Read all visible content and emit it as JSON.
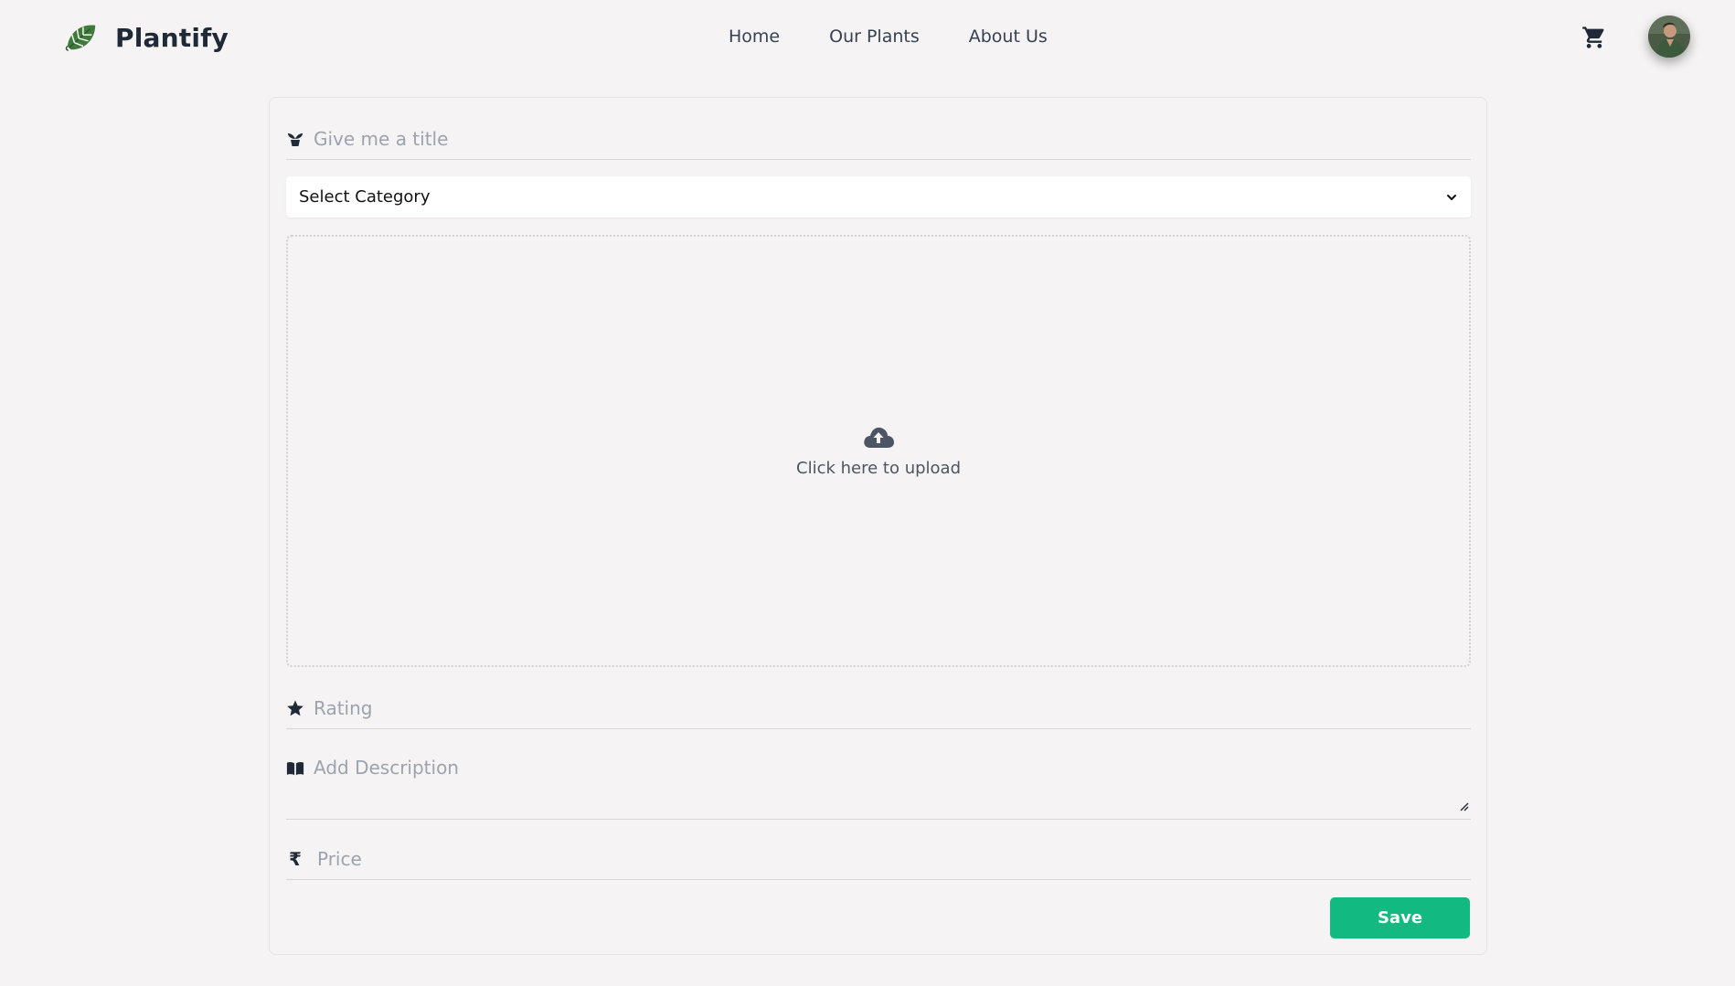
{
  "header": {
    "brand": "Plantify",
    "nav": [
      "Home",
      "Our Plants",
      "About Us"
    ]
  },
  "form": {
    "title_placeholder": "Give me a title",
    "category_selected": "Select Category",
    "upload_label": "Click here to upload",
    "rating_placeholder": "Rating",
    "description_placeholder": "Add Description",
    "price_symbol": "₹",
    "price_placeholder": "Price",
    "save_label": "Save"
  },
  "icons": {
    "brand": "monstera-leaf-icon",
    "cart": "cart-icon",
    "title": "plant-pot-icon",
    "category": "chevron-down-icon",
    "upload": "cloud-upload-icon",
    "rating": "star-icon",
    "description": "book-icon",
    "price": "rupee-icon"
  },
  "colors": {
    "background": "#f5f3f3",
    "accent": "#12b981",
    "brand_leaf": "#3f7a3c",
    "text": "#1f2937",
    "placeholder": "#9ca3af"
  }
}
